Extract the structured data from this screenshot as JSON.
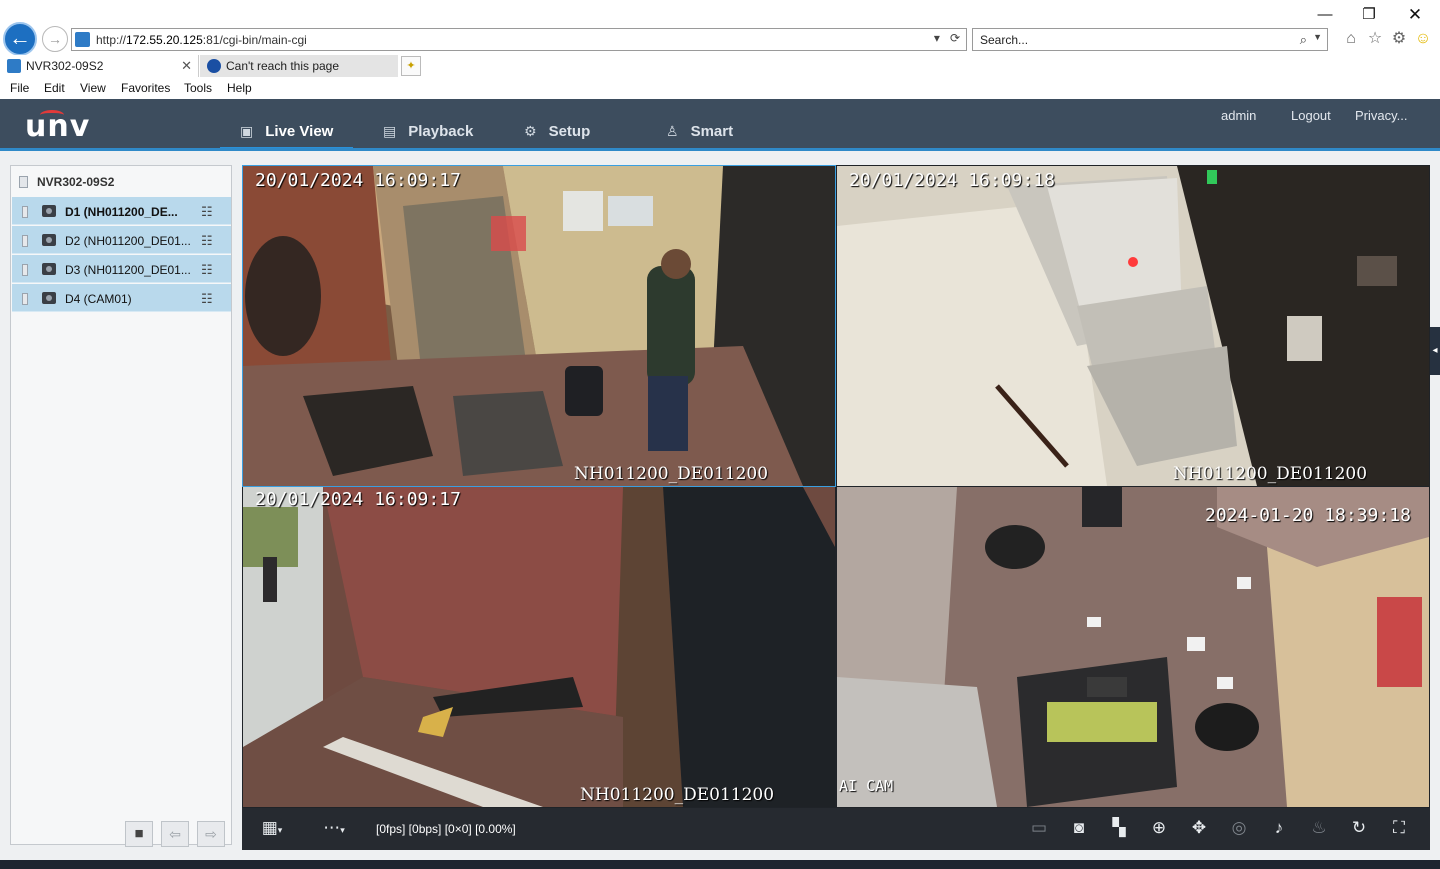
{
  "browser": {
    "url_prefix": "http://",
    "url_host": "172.55.20.125",
    "url_path": ":81/cgi-bin/main-cgi",
    "search_placeholder": "Search...",
    "tabs": [
      {
        "label": "NVR302-09S2"
      },
      {
        "label": "Can't reach this page"
      }
    ],
    "menu": [
      "File",
      "Edit",
      "View",
      "Favorites",
      "Tools",
      "Help"
    ]
  },
  "app": {
    "logo": "unv",
    "nav": [
      {
        "label": "Live View"
      },
      {
        "label": "Playback"
      },
      {
        "label": "Setup"
      },
      {
        "label": "Smart"
      }
    ],
    "user": "admin",
    "logout": "Logout",
    "privacy": "Privacy..."
  },
  "device_tree": {
    "root": "NVR302-09S2",
    "cameras": [
      {
        "label": "D1 (NH011200_DE..."
      },
      {
        "label": "D2 (NH011200_DE01..."
      },
      {
        "label": "D3 (NH011200_DE01..."
      },
      {
        "label": "D4 (CAM01)"
      }
    ]
  },
  "tiles": [
    {
      "timestamp": "20/01/2024  16:09:17",
      "name": "NH011200_DE011200"
    },
    {
      "timestamp": "20/01/2024  16:09:18",
      "name": "NH011200_DE011200"
    },
    {
      "timestamp": "20/01/2024  16:09:17",
      "name": "NH011200_DE011200"
    },
    {
      "timestamp": "2024-01-20 18:39:18",
      "name": "AI CAM"
    }
  ],
  "status": "[0fps] [0bps] [0×0] [0.00%]",
  "colors": {
    "header_bg": "#3d4d5e",
    "accent": "#2a90d8",
    "selected_row": "#b9d9ec",
    "toolbar_bg": "#262a30"
  }
}
